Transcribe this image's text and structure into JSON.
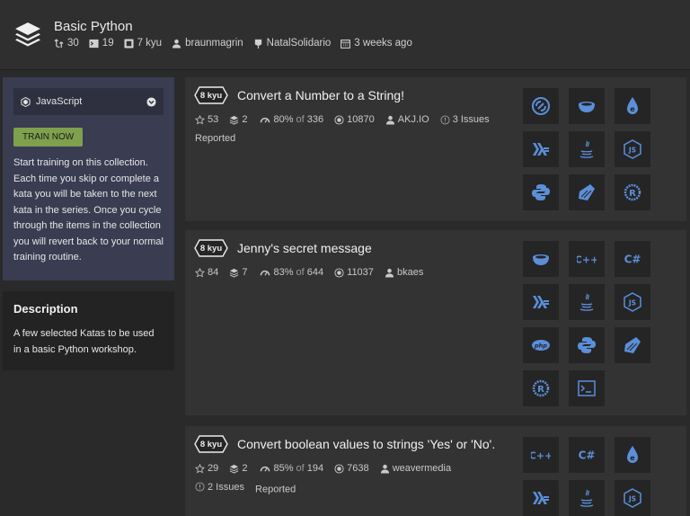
{
  "header": {
    "title": "Basic Python",
    "forks": "30",
    "katas": "19",
    "rank": "7 kyu",
    "author": "braunmagrin",
    "clan": "NatalSolidario",
    "updated": "3 weeks ago"
  },
  "sidebar": {
    "language": "JavaScript",
    "train_button": "TRAIN NOW",
    "train_text": "Start training on this collection. Each time you skip or complete a kata you will be taken to the next kata in the series. Once you cycle through the items in the collection you will revert back to your normal training routine.",
    "description_title": "Description",
    "description_text": "A few selected Katas to be used in a basic Python workshop."
  },
  "katas": [
    {
      "kyu": "8 kyu",
      "title": "Convert a Number to a String!",
      "stars": "53",
      "collections": "2",
      "satisfaction": "80%",
      "of": "of",
      "votes": "336",
      "completed": "10870",
      "author": "AKJ.IO",
      "issues": "3 Issues",
      "reported": "Reported",
      "languages": [
        "crystal-icon",
        "coffeescript-icon",
        "elixir-icon",
        "haskell-icon",
        "java-icon",
        "javascript-icon",
        "python-icon",
        "ruby-icon",
        "rust-icon"
      ]
    },
    {
      "kyu": "8 kyu",
      "title": "Jenny's secret message",
      "stars": "84",
      "collections": "7",
      "satisfaction": "83%",
      "of": "of",
      "votes": "644",
      "completed": "11037",
      "author": "bkaes",
      "languages": [
        "coffeescript-icon",
        "cpp-icon",
        "csharp-icon",
        "haskell-icon",
        "java-icon",
        "javascript-icon",
        "php-icon",
        "python-icon",
        "rust-icon",
        "shell-icon"
      ]
    },
    {
      "kyu": "8 kyu",
      "title": "Convert boolean values to strings 'Yes' or 'No'.",
      "stars": "29",
      "collections": "2",
      "satisfaction": "85%",
      "of": "of",
      "votes": "194",
      "completed": "7638",
      "author": "weavermedia",
      "issues": "2 Issues",
      "reported": "Reported",
      "languages": [
        "cpp-icon",
        "csharp-icon",
        "elixir-icon",
        "haskell-icon",
        "java-icon",
        "javascript-icon"
      ]
    }
  ],
  "colors": {
    "accent": "#5b8fd9",
    "train_button": "#7fa04d",
    "sidebar_panel": "#3a3c52",
    "page_bg": "#2a2a2b"
  }
}
